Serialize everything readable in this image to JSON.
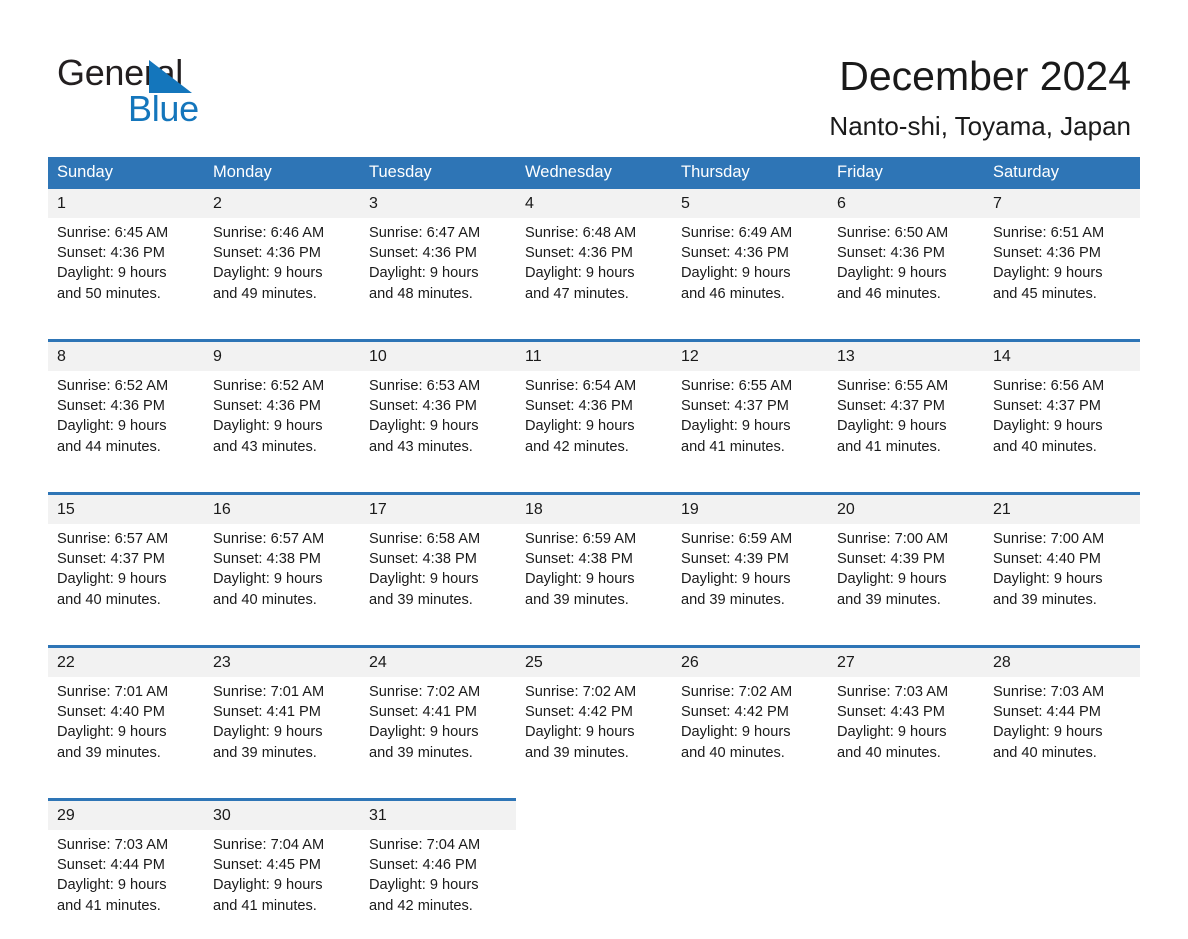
{
  "brand": {
    "name_part1": "General",
    "name_part2": "Blue",
    "triangle_icon": "triangle-icon",
    "accent_color": "#1476bc"
  },
  "header": {
    "title": "December 2024",
    "subtitle": "Nanto-shi, Toyama, Japan"
  },
  "theme": {
    "header_blue": "#2e75b6",
    "daynum_background": "#f2f2f2",
    "text_color": "#1a1a1a"
  },
  "weekdays": [
    "Sunday",
    "Monday",
    "Tuesday",
    "Wednesday",
    "Thursday",
    "Friday",
    "Saturday"
  ],
  "weeks": [
    {
      "days": [
        {
          "num": "1",
          "sunrise": "Sunrise: 6:45 AM",
          "sunset": "Sunset: 4:36 PM",
          "daylight1": "Daylight: 9 hours",
          "daylight2": "and 50 minutes."
        },
        {
          "num": "2",
          "sunrise": "Sunrise: 6:46 AM",
          "sunset": "Sunset: 4:36 PM",
          "daylight1": "Daylight: 9 hours",
          "daylight2": "and 49 minutes."
        },
        {
          "num": "3",
          "sunrise": "Sunrise: 6:47 AM",
          "sunset": "Sunset: 4:36 PM",
          "daylight1": "Daylight: 9 hours",
          "daylight2": "and 48 minutes."
        },
        {
          "num": "4",
          "sunrise": "Sunrise: 6:48 AM",
          "sunset": "Sunset: 4:36 PM",
          "daylight1": "Daylight: 9 hours",
          "daylight2": "and 47 minutes."
        },
        {
          "num": "5",
          "sunrise": "Sunrise: 6:49 AM",
          "sunset": "Sunset: 4:36 PM",
          "daylight1": "Daylight: 9 hours",
          "daylight2": "and 46 minutes."
        },
        {
          "num": "6",
          "sunrise": "Sunrise: 6:50 AM",
          "sunset": "Sunset: 4:36 PM",
          "daylight1": "Daylight: 9 hours",
          "daylight2": "and 46 minutes."
        },
        {
          "num": "7",
          "sunrise": "Sunrise: 6:51 AM",
          "sunset": "Sunset: 4:36 PM",
          "daylight1": "Daylight: 9 hours",
          "daylight2": "and 45 minutes."
        }
      ]
    },
    {
      "days": [
        {
          "num": "8",
          "sunrise": "Sunrise: 6:52 AM",
          "sunset": "Sunset: 4:36 PM",
          "daylight1": "Daylight: 9 hours",
          "daylight2": "and 44 minutes."
        },
        {
          "num": "9",
          "sunrise": "Sunrise: 6:52 AM",
          "sunset": "Sunset: 4:36 PM",
          "daylight1": "Daylight: 9 hours",
          "daylight2": "and 43 minutes."
        },
        {
          "num": "10",
          "sunrise": "Sunrise: 6:53 AM",
          "sunset": "Sunset: 4:36 PM",
          "daylight1": "Daylight: 9 hours",
          "daylight2": "and 43 minutes."
        },
        {
          "num": "11",
          "sunrise": "Sunrise: 6:54 AM",
          "sunset": "Sunset: 4:36 PM",
          "daylight1": "Daylight: 9 hours",
          "daylight2": "and 42 minutes."
        },
        {
          "num": "12",
          "sunrise": "Sunrise: 6:55 AM",
          "sunset": "Sunset: 4:37 PM",
          "daylight1": "Daylight: 9 hours",
          "daylight2": "and 41 minutes."
        },
        {
          "num": "13",
          "sunrise": "Sunrise: 6:55 AM",
          "sunset": "Sunset: 4:37 PM",
          "daylight1": "Daylight: 9 hours",
          "daylight2": "and 41 minutes."
        },
        {
          "num": "14",
          "sunrise": "Sunrise: 6:56 AM",
          "sunset": "Sunset: 4:37 PM",
          "daylight1": "Daylight: 9 hours",
          "daylight2": "and 40 minutes."
        }
      ]
    },
    {
      "days": [
        {
          "num": "15",
          "sunrise": "Sunrise: 6:57 AM",
          "sunset": "Sunset: 4:37 PM",
          "daylight1": "Daylight: 9 hours",
          "daylight2": "and 40 minutes."
        },
        {
          "num": "16",
          "sunrise": "Sunrise: 6:57 AM",
          "sunset": "Sunset: 4:38 PM",
          "daylight1": "Daylight: 9 hours",
          "daylight2": "and 40 minutes."
        },
        {
          "num": "17",
          "sunrise": "Sunrise: 6:58 AM",
          "sunset": "Sunset: 4:38 PM",
          "daylight1": "Daylight: 9 hours",
          "daylight2": "and 39 minutes."
        },
        {
          "num": "18",
          "sunrise": "Sunrise: 6:59 AM",
          "sunset": "Sunset: 4:38 PM",
          "daylight1": "Daylight: 9 hours",
          "daylight2": "and 39 minutes."
        },
        {
          "num": "19",
          "sunrise": "Sunrise: 6:59 AM",
          "sunset": "Sunset: 4:39 PM",
          "daylight1": "Daylight: 9 hours",
          "daylight2": "and 39 minutes."
        },
        {
          "num": "20",
          "sunrise": "Sunrise: 7:00 AM",
          "sunset": "Sunset: 4:39 PM",
          "daylight1": "Daylight: 9 hours",
          "daylight2": "and 39 minutes."
        },
        {
          "num": "21",
          "sunrise": "Sunrise: 7:00 AM",
          "sunset": "Sunset: 4:40 PM",
          "daylight1": "Daylight: 9 hours",
          "daylight2": "and 39 minutes."
        }
      ]
    },
    {
      "days": [
        {
          "num": "22",
          "sunrise": "Sunrise: 7:01 AM",
          "sunset": "Sunset: 4:40 PM",
          "daylight1": "Daylight: 9 hours",
          "daylight2": "and 39 minutes."
        },
        {
          "num": "23",
          "sunrise": "Sunrise: 7:01 AM",
          "sunset": "Sunset: 4:41 PM",
          "daylight1": "Daylight: 9 hours",
          "daylight2": "and 39 minutes."
        },
        {
          "num": "24",
          "sunrise": "Sunrise: 7:02 AM",
          "sunset": "Sunset: 4:41 PM",
          "daylight1": "Daylight: 9 hours",
          "daylight2": "and 39 minutes."
        },
        {
          "num": "25",
          "sunrise": "Sunrise: 7:02 AM",
          "sunset": "Sunset: 4:42 PM",
          "daylight1": "Daylight: 9 hours",
          "daylight2": "and 39 minutes."
        },
        {
          "num": "26",
          "sunrise": "Sunrise: 7:02 AM",
          "sunset": "Sunset: 4:42 PM",
          "daylight1": "Daylight: 9 hours",
          "daylight2": "and 40 minutes."
        },
        {
          "num": "27",
          "sunrise": "Sunrise: 7:03 AM",
          "sunset": "Sunset: 4:43 PM",
          "daylight1": "Daylight: 9 hours",
          "daylight2": "and 40 minutes."
        },
        {
          "num": "28",
          "sunrise": "Sunrise: 7:03 AM",
          "sunset": "Sunset: 4:44 PM",
          "daylight1": "Daylight: 9 hours",
          "daylight2": "and 40 minutes."
        }
      ]
    },
    {
      "days": [
        {
          "num": "29",
          "sunrise": "Sunrise: 7:03 AM",
          "sunset": "Sunset: 4:44 PM",
          "daylight1": "Daylight: 9 hours",
          "daylight2": "and 41 minutes."
        },
        {
          "num": "30",
          "sunrise": "Sunrise: 7:04 AM",
          "sunset": "Sunset: 4:45 PM",
          "daylight1": "Daylight: 9 hours",
          "daylight2": "and 41 minutes."
        },
        {
          "num": "31",
          "sunrise": "Sunrise: 7:04 AM",
          "sunset": "Sunset: 4:46 PM",
          "daylight1": "Daylight: 9 hours",
          "daylight2": "and 42 minutes."
        },
        {
          "num": "",
          "sunrise": "",
          "sunset": "",
          "daylight1": "",
          "daylight2": "",
          "empty": true
        },
        {
          "num": "",
          "sunrise": "",
          "sunset": "",
          "daylight1": "",
          "daylight2": "",
          "empty": true
        },
        {
          "num": "",
          "sunrise": "",
          "sunset": "",
          "daylight1": "",
          "daylight2": "",
          "empty": true
        },
        {
          "num": "",
          "sunrise": "",
          "sunset": "",
          "daylight1": "",
          "daylight2": "",
          "empty": true
        }
      ]
    }
  ]
}
